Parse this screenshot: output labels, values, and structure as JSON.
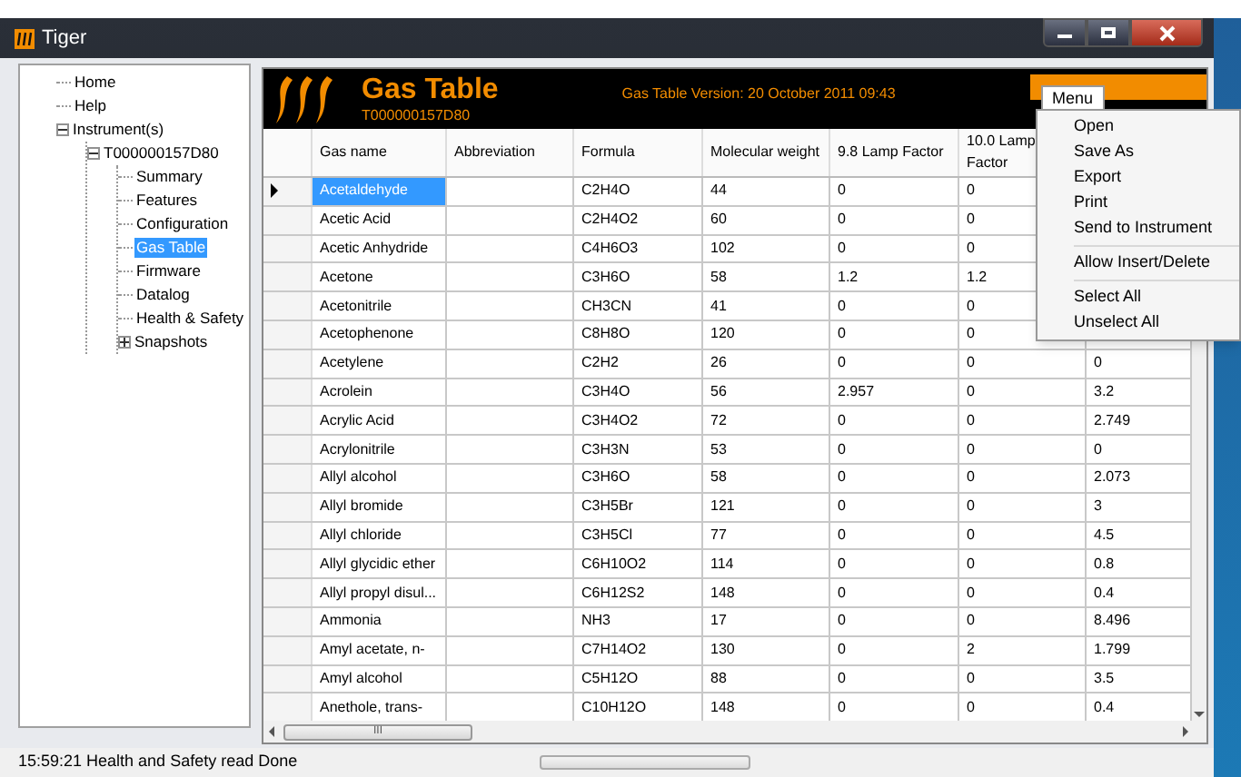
{
  "window": {
    "title": "Tiger"
  },
  "tree": [
    {
      "label": "Home",
      "selected": false
    },
    {
      "label": "Help",
      "selected": false
    },
    {
      "label": "Instrument(s)",
      "selected": false,
      "expanded": true,
      "children": [
        {
          "label": "T000000157D80",
          "selected": false,
          "expanded": true,
          "children": [
            {
              "label": "Summary",
              "selected": false
            },
            {
              "label": "Features",
              "selected": false
            },
            {
              "label": "Configuration",
              "selected": false
            },
            {
              "label": "Gas Table",
              "selected": true
            },
            {
              "label": "Firmware",
              "selected": false
            },
            {
              "label": "Datalog",
              "selected": false
            },
            {
              "label": "Health & Safety",
              "selected": false
            },
            {
              "label": "Snapshots",
              "selected": false,
              "expanded": false
            }
          ]
        }
      ]
    }
  ],
  "header": {
    "title": "Gas Table",
    "subtitle": "T000000157D80",
    "version": "Gas Table Version: 20 October 2011 09:43"
  },
  "menu": {
    "label": "Menu",
    "groups": [
      [
        "Open",
        "Save As",
        "Export",
        "Print",
        "Send to Instrument"
      ],
      [
        "Allow Insert/Delete"
      ],
      [
        "Select All",
        "Unselect All"
      ]
    ]
  },
  "table": {
    "columns": [
      "Gas name",
      "Abbreviation",
      "Formula",
      "Molecular weight",
      "9.8 Lamp Factor",
      "10.0 Lamp Factor"
    ],
    "rows": [
      {
        "selected": true,
        "cells": [
          "Acetaldehyde",
          "",
          "C2H4O",
          "44",
          "0",
          "0"
        ]
      },
      {
        "selected": false,
        "cells": [
          "Acetic Acid",
          "",
          "C2H4O2",
          "60",
          "0",
          "0"
        ]
      },
      {
        "selected": false,
        "cells": [
          "Acetic Anhydride",
          "",
          "C4H6O3",
          "102",
          "0",
          "0"
        ]
      },
      {
        "selected": false,
        "cells": [
          "Acetone",
          "",
          "C3H6O",
          "58",
          "1.2",
          "1.2"
        ]
      },
      {
        "selected": false,
        "cells": [
          "Acetonitrile",
          "",
          "CH3CN",
          "41",
          "0",
          "0"
        ]
      },
      {
        "selected": false,
        "cells": [
          "Acetophenone",
          "",
          "C8H8O",
          "120",
          "0",
          "0"
        ]
      },
      {
        "selected": false,
        "cells": [
          "Acetylene",
          "",
          "C2H2",
          "26",
          "0",
          "0"
        ],
        "column_7": "0"
      },
      {
        "selected": false,
        "cells": [
          "Acrolein",
          "",
          "C3H4O",
          "56",
          "2.957",
          "0"
        ],
        "column_7": "3.2"
      },
      {
        "selected": false,
        "cells": [
          "Acrylic Acid",
          "",
          "C3H4O2",
          "72",
          "0",
          "0"
        ],
        "column_7": "2.749"
      },
      {
        "selected": false,
        "cells": [
          "Acrylonitrile",
          "",
          "C3H3N",
          "53",
          "0",
          "0"
        ],
        "column_7": "0"
      },
      {
        "selected": false,
        "cells": [
          "Allyl alcohol",
          "",
          "C3H6O",
          "58",
          "0",
          "0"
        ],
        "column_7": "2.073"
      },
      {
        "selected": false,
        "cells": [
          "Allyl bromide",
          "",
          "C3H5Br",
          "121",
          "0",
          "0"
        ],
        "column_7": "3"
      },
      {
        "selected": false,
        "cells": [
          "Allyl chloride",
          "",
          "C3H5Cl",
          "77",
          "0",
          "0"
        ],
        "column_7": "4.5"
      },
      {
        "selected": false,
        "cells": [
          "Allyl glycidic ether",
          "",
          "C6H10O2",
          "114",
          "0",
          "0"
        ],
        "column_7": "0.8"
      },
      {
        "selected": false,
        "cells": [
          "Allyl propyl disul...",
          "",
          "C6H12S2",
          "148",
          "0",
          "0"
        ],
        "column_7": "0.4"
      },
      {
        "selected": false,
        "cells": [
          "Ammonia",
          "",
          "NH3",
          "17",
          "0",
          "0"
        ],
        "column_7": "8.496"
      },
      {
        "selected": false,
        "cells": [
          "Amyl acetate, n-",
          "",
          "C7H14O2",
          "130",
          "0",
          "2"
        ],
        "column_7": "1.799"
      },
      {
        "selected": false,
        "cells": [
          "Amyl alcohol",
          "",
          "C5H12O",
          "88",
          "0",
          "0"
        ],
        "column_7": "3.5"
      },
      {
        "selected": false,
        "cells": [
          "Anethole, trans-",
          "",
          "C10H12O",
          "148",
          "0",
          "0"
        ],
        "column_7": "0.4"
      }
    ]
  },
  "scrollbar": {
    "grip": "III"
  },
  "status_bar": {
    "message": "15:59:21 Health and Safety read Done",
    "progress": {
      "level": 0
    }
  }
}
